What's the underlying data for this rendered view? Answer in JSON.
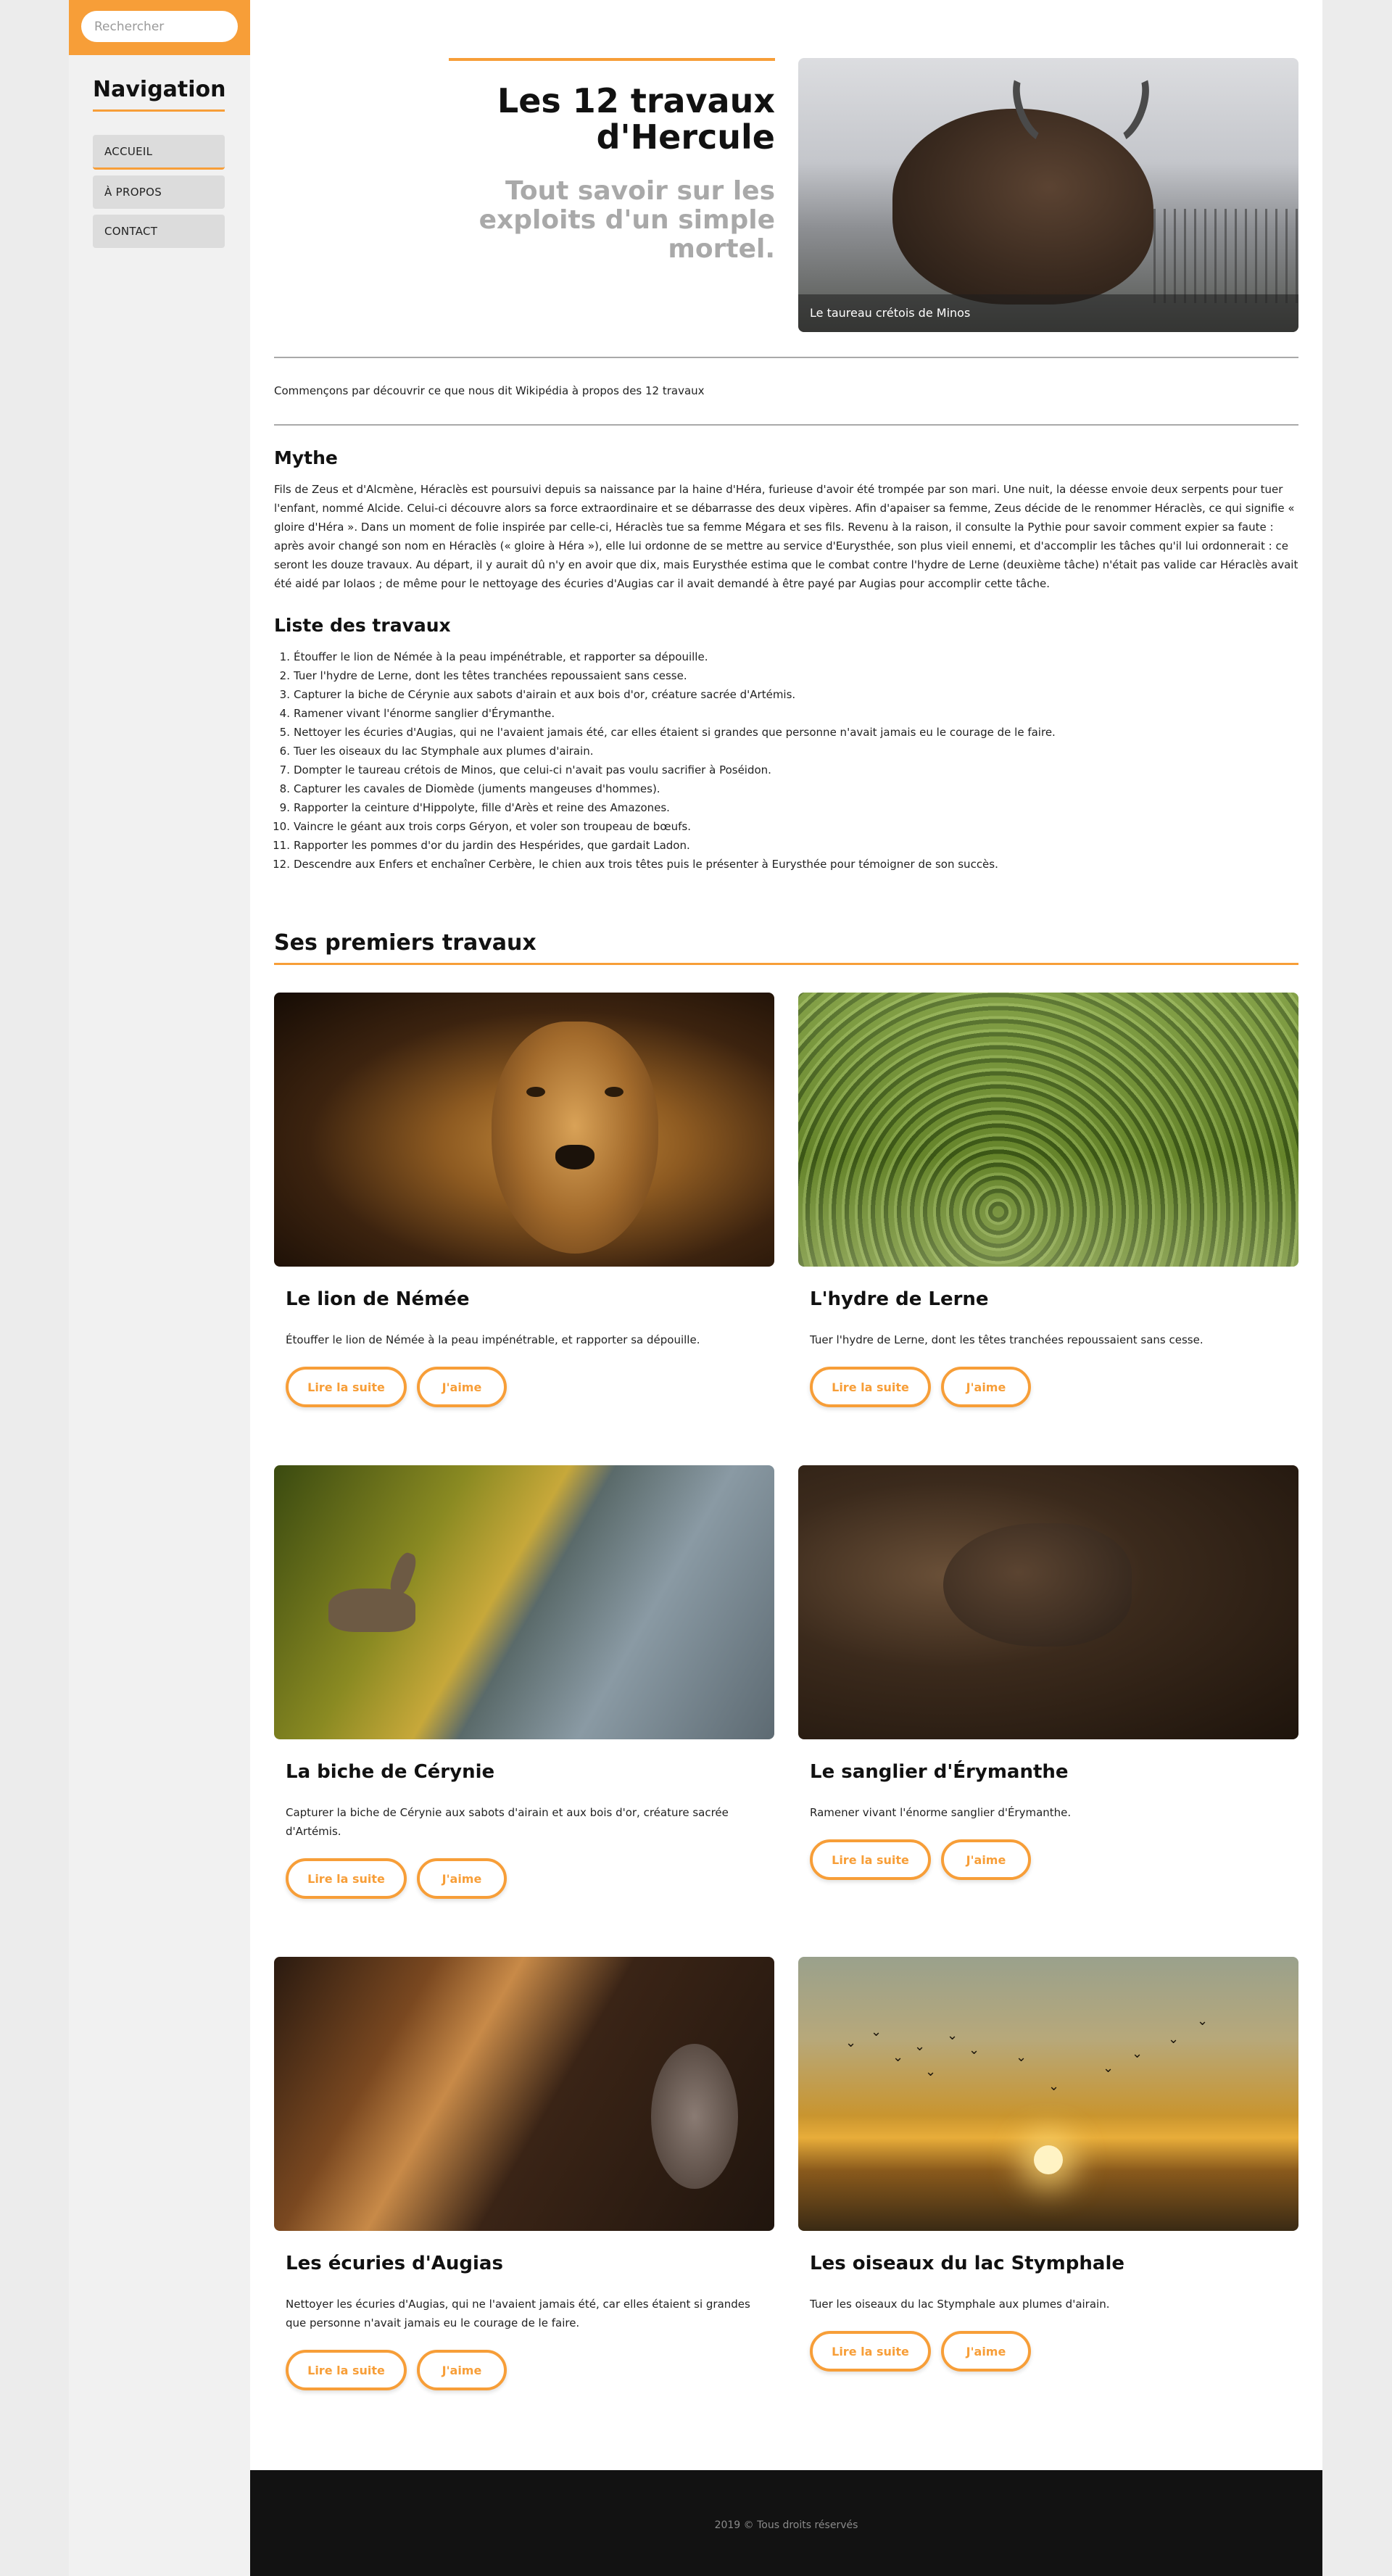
{
  "sidebar": {
    "search_placeholder": "Rechercher",
    "nav_title": "Navigation",
    "items": [
      {
        "label": "ACCUEIL"
      },
      {
        "label": "À PROPOS"
      },
      {
        "label": "CONTACT"
      }
    ]
  },
  "hero": {
    "title": "Les 12 travaux d'Hercule",
    "subtitle": "Tout savoir sur les exploits d'un simple mortel.",
    "image_caption": "Le taureau crétois de Minos"
  },
  "intro": "Commençons par découvrir ce que nous dit Wikipédia à propos des 12 travaux",
  "myth": {
    "heading": "Mythe",
    "text": "Fils de Zeus et d'Alcmène, Héraclès est poursuivi depuis sa naissance par la haine d'Héra, furieuse d'avoir été trompée par son mari. Une nuit, la déesse envoie deux serpents pour tuer l'enfant, nommé Alcide. Celui-ci découvre alors sa force extraordinaire et se débarrasse des deux vipères. Afin d'apaiser sa femme, Zeus décide de le renommer Héraclès, ce qui signifie « gloire d'Héra ». Dans un moment de folie inspirée par celle-ci, Héraclès tue sa femme Mégara et ses fils. Revenu à la raison, il consulte la Pythie pour savoir comment expier sa faute : après avoir changé son nom en Héraclès (« gloire à Héra »), elle lui ordonne de se mettre au service d'Eurysthée, son plus vieil ennemi, et d'accomplir les tâches qu'il lui ordonnerait : ce seront les douze travaux. Au départ, il y aurait dû n'y en avoir que dix, mais Eurysthée estima que le combat contre l'hydre de Lerne (deuxième tâche) n'était pas valide car Héraclès avait été aidé par Iolaos ; de même pour le nettoyage des écuries d'Augias car il avait demandé à être payé par Augias pour accomplir cette tâche."
  },
  "labors": {
    "heading": "Liste des travaux",
    "items": [
      "Étouffer le lion de Némée à la peau impénétrable, et rapporter sa dépouille.",
      "Tuer l'hydre de Lerne, dont les têtes tranchées repoussaient sans cesse.",
      "Capturer la biche de Cérynie aux sabots d'airain et aux bois d'or, créature sacrée d'Artémis.",
      "Ramener vivant l'énorme sanglier d'Érymanthe.",
      "Nettoyer les écuries d'Augias, qui ne l'avaient jamais été, car elles étaient si grandes que personne n'avait jamais eu le courage de le faire.",
      "Tuer les oiseaux du lac Stymphale aux plumes d'airain.",
      "Dompter le taureau crétois de Minos, que celui-ci n'avait pas voulu sacrifier à Poséidon.",
      "Capturer les cavales de Diomède (juments mangeuses d'hommes).",
      "Rapporter la ceinture d'Hippolyte, fille d'Arès et reine des Amazones.",
      "Vaincre le géant aux trois corps Géryon, et voler son troupeau de bœufs.",
      "Rapporter les pommes d'or du jardin des Hespérides, que gardait Ladon.",
      "Descendre aux Enfers et enchaîner Cerbère, le chien aux trois têtes puis le présenter à Eurysthée pour témoigner de son succès."
    ]
  },
  "cards_section": {
    "heading": "Ses premiers travaux",
    "read_label": "Lire la suite",
    "like_label": "J'aime",
    "cards": [
      {
        "title": "Le lion de Némée",
        "desc": "Étouffer le lion de Némée à la peau impénétrable, et rapporter sa dépouille."
      },
      {
        "title": "L'hydre de Lerne",
        "desc": "Tuer l'hydre de Lerne, dont les têtes tranchées repoussaient sans cesse."
      },
      {
        "title": "La biche de Cérynie",
        "desc": "Capturer la biche de Cérynie aux sabots d'airain et aux bois d'or, créature sacrée d'Artémis."
      },
      {
        "title": "Le sanglier d'Érymanthe",
        "desc": "Ramener vivant l'énorme sanglier d'Érymanthe."
      },
      {
        "title": "Les écuries d'Augias",
        "desc": "Nettoyer les écuries d'Augias, qui ne l'avaient jamais été, car elles étaient si grandes que personne n'avait jamais eu le courage de le faire."
      },
      {
        "title": "Les oiseaux du lac Stymphale",
        "desc": "Tuer les oiseaux du lac Stymphale aux plumes d'airain."
      }
    ]
  },
  "footer": {
    "text": "2019 © Tous droits réservés"
  },
  "colors": {
    "accent": "#f79e38",
    "footer_bg": "#121212"
  }
}
